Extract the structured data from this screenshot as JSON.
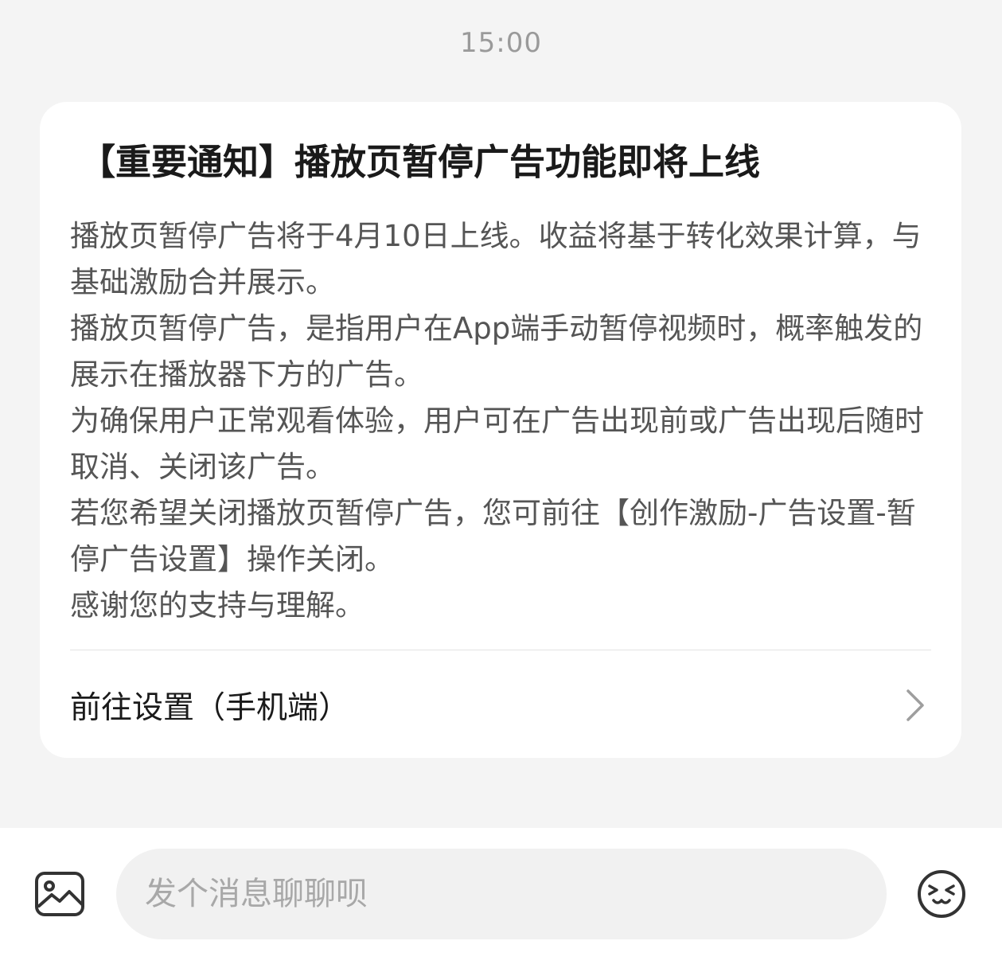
{
  "chat": {
    "timestamp": "15:00"
  },
  "notice": {
    "title": "【重要通知】播放页暂停广告功能即将上线",
    "paragraphs": [
      "播放页暂停广告将于4月10日上线。收益将基于转化效果计算，与基础激励合并展示。",
      "播放页暂停广告，是指用户在App端手动暂停视频时，概率触发的展示在播放器下方的广告。",
      "为确保用户正常观看体验，用户可在广告出现前或广告出现后随时取消、关闭该广告。",
      "若您希望关闭播放页暂停广告，您可前往【创作激励-广告设置-暂停广告设置】操作关闭。",
      "感谢您的支持与理解。"
    ],
    "action_label": "前往设置（手机端）",
    "action_icon": "chevron-right-icon"
  },
  "composer": {
    "placeholder": "发个消息聊聊呗",
    "image_icon": "image-icon",
    "emoji_icon": "emoji-icon"
  }
}
